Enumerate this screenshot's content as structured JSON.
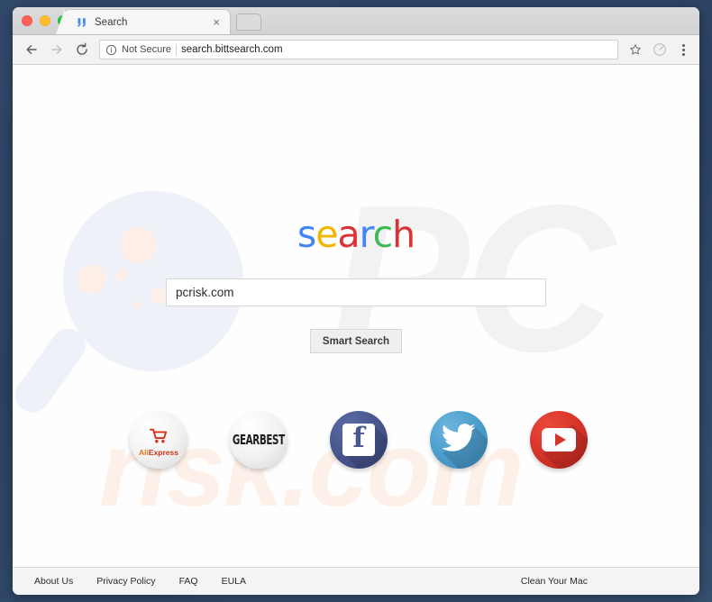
{
  "window": {
    "traffic_lights": [
      "close",
      "minimize",
      "zoom"
    ]
  },
  "tab": {
    "favicon_name": "bittsearch-favicon",
    "title": "Search",
    "close_label": "×",
    "new_tab_label": ""
  },
  "toolbar": {
    "back_label": "←",
    "forward_label": "→",
    "reload_label": "⟳",
    "security_text": "Not Secure",
    "url": "search.bittsearch.com",
    "info_icon": "info-circle-icon",
    "star_icon": "star-icon",
    "extension_icon": "extension-icon",
    "menu_icon": "three-dot-menu-icon"
  },
  "page": {
    "logo": {
      "letters": [
        {
          "char": "s",
          "color": "#4285f4"
        },
        {
          "char": "e",
          "color": "#f4b400"
        },
        {
          "char": "a",
          "color": "#db3236"
        },
        {
          "char": "r",
          "color": "#4285f4"
        },
        {
          "char": "c",
          "color": "#3cba54"
        },
        {
          "char": "h",
          "color": "#db3236"
        }
      ],
      "text": "search"
    },
    "search": {
      "value": "pcrisk.com",
      "placeholder": "",
      "button_label": "Smart Search"
    },
    "shortcuts": [
      {
        "name": "aliexpress",
        "label": "AliExpress",
        "word_ali": "Ali",
        "word_express": "xpress",
        "cart": "🛒"
      },
      {
        "name": "gearbest",
        "label": "GEARBEST"
      },
      {
        "name": "facebook",
        "label": "f"
      },
      {
        "name": "twitter",
        "label": "Twitter"
      },
      {
        "name": "youtube",
        "label": "YouTube"
      }
    ],
    "watermark": {
      "brand_big": "PC",
      "brand_small": "risk.com"
    }
  },
  "footer": {
    "links": [
      {
        "label": "About Us"
      },
      {
        "label": "Privacy Policy"
      },
      {
        "label": "FAQ"
      },
      {
        "label": "EULA"
      }
    ],
    "right_label": "Clean Your Mac"
  },
  "colors": {
    "desktop": "#2c4566",
    "accent_blue": "#4285f4",
    "accent_red": "#db3236",
    "accent_yellow": "#f4b400",
    "accent_green": "#3cba54"
  }
}
